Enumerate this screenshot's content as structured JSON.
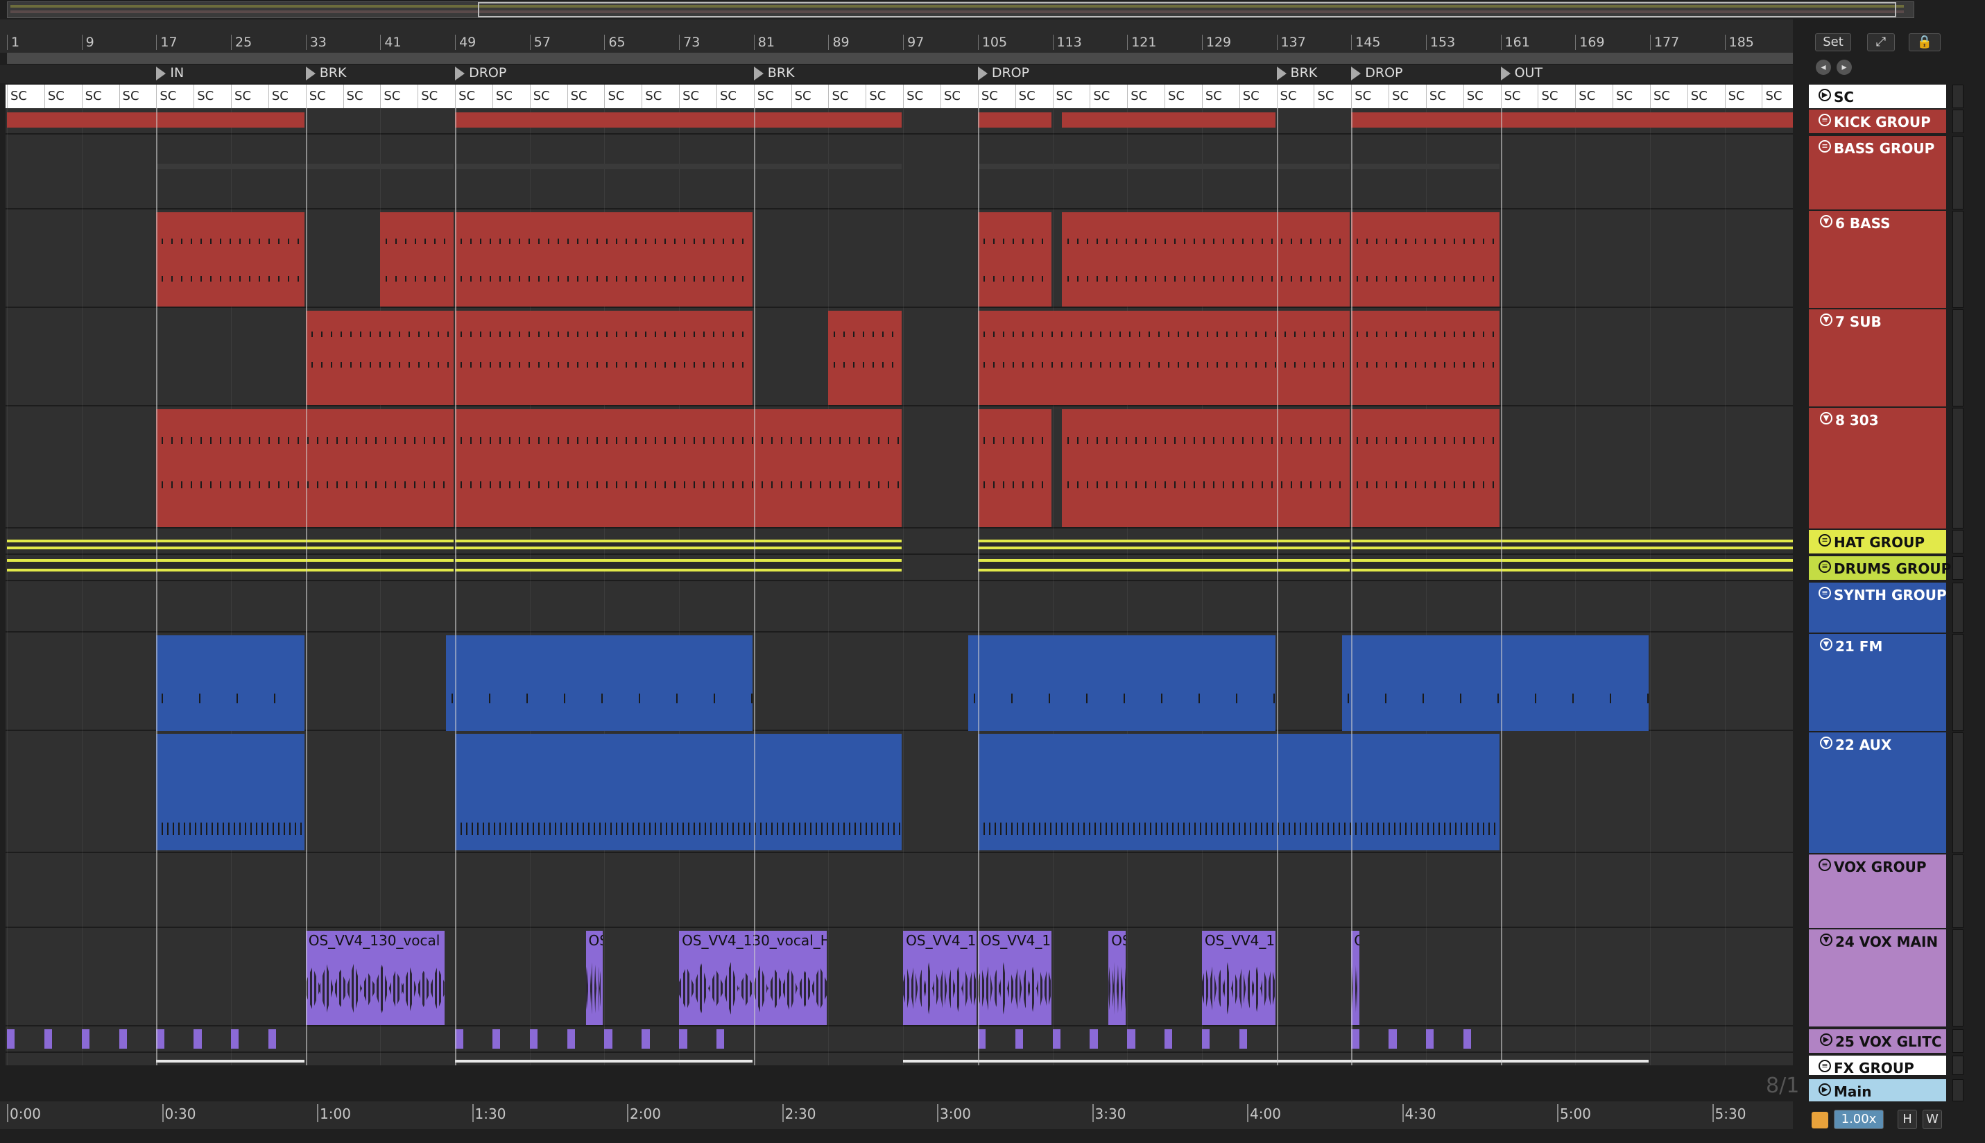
{
  "bar_numbers": [
    "1",
    "9",
    "17",
    "25",
    "33",
    "41",
    "49",
    "57",
    "65",
    "73",
    "81",
    "89",
    "97",
    "105",
    "113",
    "121",
    "129",
    "137",
    "145",
    "153",
    "161",
    "169",
    "177",
    "185"
  ],
  "locators": [
    "IN",
    "BRK",
    "DROP",
    "BRK",
    "DROP",
    "BRK",
    "DROP",
    "OUT"
  ],
  "sc_label": "SC",
  "time_labels": [
    "0:00",
    "0:30",
    "1:00",
    "1:30",
    "2:00",
    "2:30",
    "3:00",
    "3:30",
    "4:00",
    "4:30",
    "5:00",
    "5:30"
  ],
  "clip_names": {
    "vocal_1": "OS_VV4_130_vocal",
    "vocal_2": "OS",
    "vocal_3": "OS_VV4_130_vocal_H",
    "vocal_4": "OS_VV4_1",
    "vocal_5": "OS_VV4_1",
    "vocal_6": "OS",
    "vocal_7": "OS_VV4_1",
    "vocal_8": "O"
  },
  "tracks": {
    "sc": "SC",
    "kick_group": "KICK GROUP",
    "bass_group": "BASS GROUP",
    "bass_6": "6 BASS",
    "sub_7": "7 SUB",
    "acid_303": "8 303",
    "hat_group": "HAT GROUP",
    "drums_group": "DRUMS GROUP",
    "synth_group": "SYNTH GROUP",
    "fm_21": "21 FM",
    "aux_22": "22 AUX",
    "vox_group": "VOX GROUP",
    "vox_main": "24 VOX MAIN",
    "vox_glitch": "25 VOX GLITC",
    "fx_group": "FX GROUP",
    "main": "Main"
  },
  "toolbar": {
    "set_label": "Set",
    "zoom_label": "1.00x",
    "h_label": "H",
    "w_label": "W",
    "time_sig": "8/1"
  },
  "colors": {
    "bass_red": "#a83a36",
    "hat_yellow": "#e2e94a",
    "synth_blue": "#2f56a8",
    "vox_purple": "#8b6ad6",
    "vox_group_lilac": "#b183c4",
    "main_lightblue": "#aad4ea"
  }
}
